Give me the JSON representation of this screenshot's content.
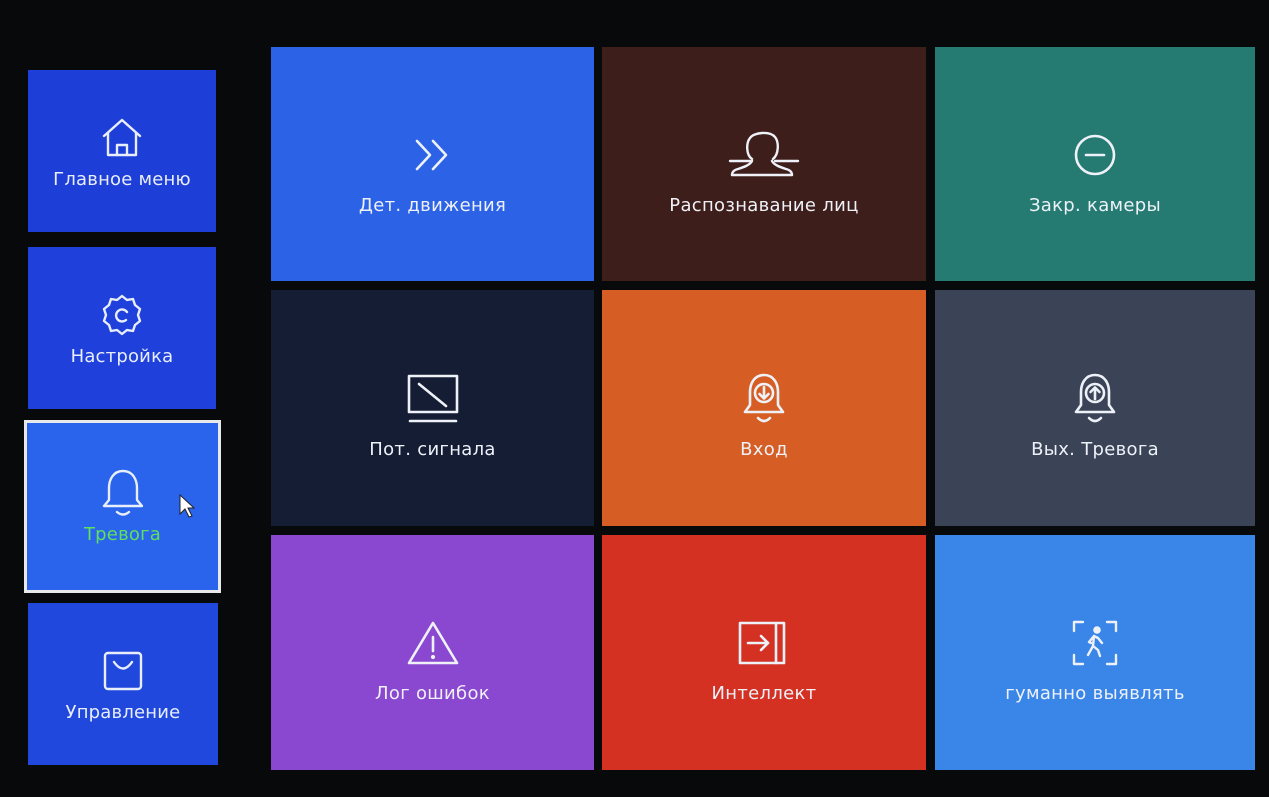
{
  "sidebar": {
    "items": [
      {
        "label": "Главное меню",
        "icon": "home-icon",
        "selected": false
      },
      {
        "label": "Настройка",
        "icon": "gear-icon",
        "selected": false
      },
      {
        "label": "Тревога",
        "icon": "bell-icon",
        "selected": true
      },
      {
        "label": "Управление",
        "icon": "bag-icon",
        "selected": false
      }
    ]
  },
  "tiles": [
    {
      "label": "Дет. движения",
      "icon": "double-chevron-right-icon",
      "color": "#2c62e6"
    },
    {
      "label": "Распознавание лиц",
      "icon": "face-profile-icon",
      "color": "#3d1d1a"
    },
    {
      "label": "Закр. камеры",
      "icon": "minus-circle-icon",
      "color": "#257a72"
    },
    {
      "label": "Пот. сигнала",
      "icon": "monitor-slash-icon",
      "color": "#141d33"
    },
    {
      "label": "Вход",
      "icon": "bell-down-icon",
      "color": "#d65e24"
    },
    {
      "label": "Вых. Тревога",
      "icon": "bell-up-icon",
      "color": "#3a4456"
    },
    {
      "label": "Лог ошибок",
      "icon": "warning-triangle-icon",
      "color": "#8a47cf"
    },
    {
      "label": "Интеллект",
      "icon": "enter-box-icon",
      "color": "#d43123"
    },
    {
      "label": "гуманно выявлять",
      "icon": "human-detect-icon",
      "color": "#3a86e8"
    }
  ],
  "colors": {
    "sidebar_item": "#1f3fd9",
    "sidebar_selected": "#2a64ee",
    "selected_border": "#e9e9ec",
    "selected_label": "#5ee05e",
    "background": "#08090b"
  }
}
